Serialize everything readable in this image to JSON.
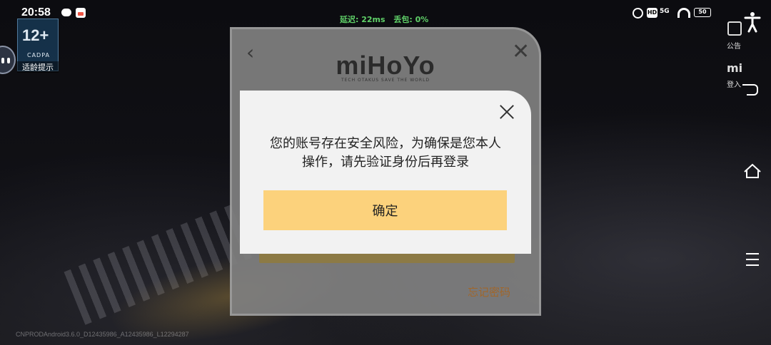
{
  "status_bar": {
    "time": "20:58",
    "network": {
      "latency": "延迟: 22ms",
      "packet_loss": "丢包: 0%"
    },
    "battery": "50"
  },
  "overlay": {
    "age_rating": {
      "number": "12+",
      "org": "CADPA",
      "tip": "适龄提示"
    },
    "side_menu": {
      "notice_label": "公告",
      "login_icon": "mi",
      "login_label": "登入"
    }
  },
  "login_panel": {
    "logo": "miHoYo",
    "slogan": "TECH OTAKUS SAVE THE WORLD",
    "forgot_password": "忘记密码"
  },
  "dialog": {
    "message": "您的账号存在安全风险，为确保是您本人操作，请先验证身份后再登录",
    "confirm_label": "确定"
  },
  "build_info": "CNPRODAndroid3.6.0_D12435986_A12435986_L12294287",
  "colors": {
    "confirm_button": "#fcd27c",
    "dialog_bg": "#f2f2f2",
    "latency_text": "#5fd068",
    "forgot_text": "#a0662a"
  },
  "icons": [
    "message-icon",
    "app-icon",
    "alarm-icon",
    "hd-icon",
    "wifi-icon",
    "battery-icon",
    "accessibility-icon",
    "back-icon",
    "home-icon",
    "recent-apps-icon",
    "close-icon",
    "chevron-left-icon",
    "notice-icon"
  ]
}
